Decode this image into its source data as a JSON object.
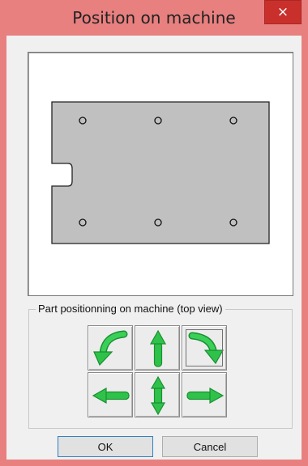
{
  "window": {
    "title": "Position on machine",
    "close_label": "×"
  },
  "group": {
    "label": "Part positionning on machine (top view)"
  },
  "buttons": {
    "ok": "OK",
    "cancel": "Cancel"
  },
  "colors": {
    "part_fill": "#c0c0c0",
    "arrow_green": "#2fc24a",
    "title_bar": "#e8807f"
  },
  "icons": {
    "rotate_ccw": "rotate-counterclockwise-arrow",
    "up": "arrow-up",
    "rotate_cw": "rotate-clockwise-arrow",
    "left": "arrow-left",
    "up_down": "arrow-up-down",
    "right": "arrow-right"
  }
}
